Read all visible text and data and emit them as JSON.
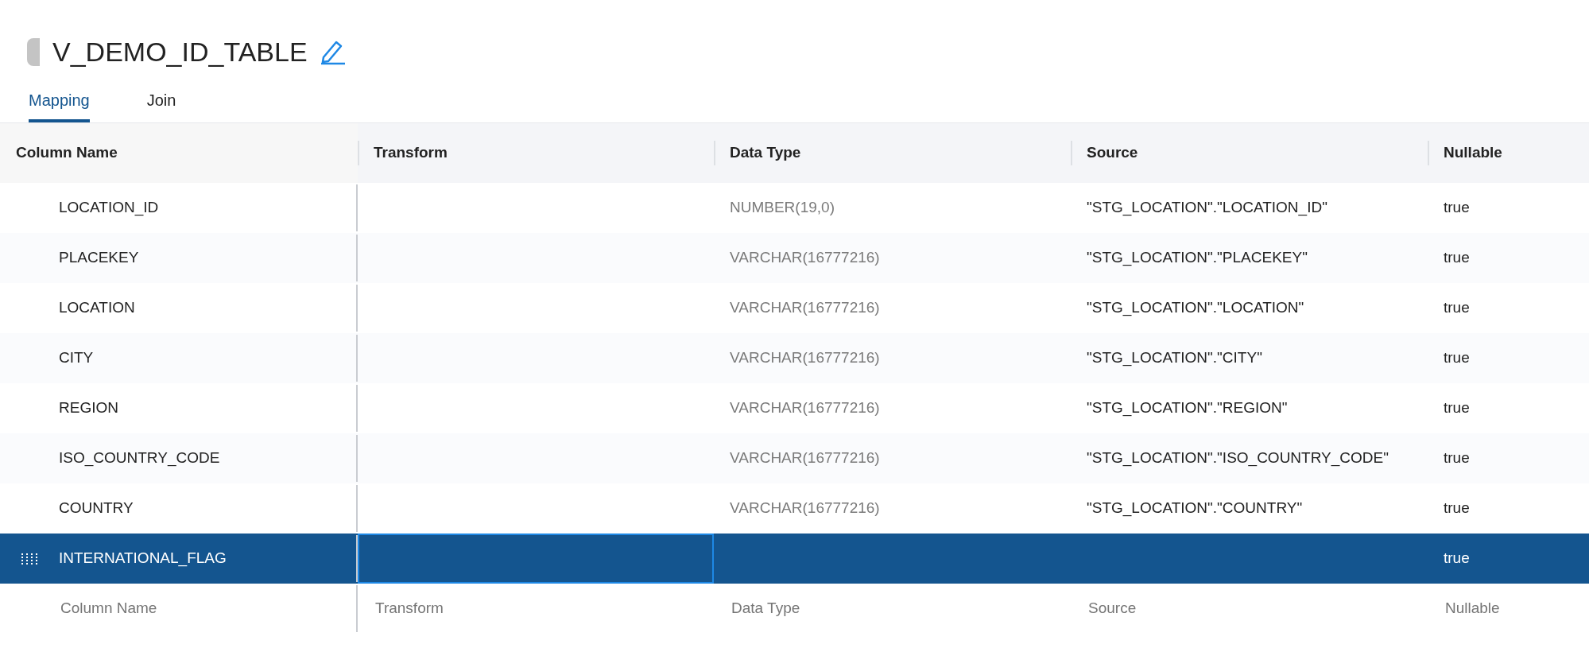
{
  "title": "V_DEMO_ID_TABLE",
  "tabs": [
    {
      "label": "Mapping",
      "selected": true
    },
    {
      "label": "Join",
      "selected": false
    }
  ],
  "table": {
    "columns": [
      "Column Name",
      "Transform",
      "Data Type",
      "Source",
      "Nullable"
    ],
    "rows": [
      {
        "column_name": "LOCATION_ID",
        "data_type": "NUMBER(19,0)",
        "source": "\"STG_LOCATION\".\"LOCATION_ID\"",
        "nullable": "true",
        "selected": false
      },
      {
        "column_name": "PLACEKEY",
        "data_type": "VARCHAR(16777216)",
        "source": "\"STG_LOCATION\".\"PLACEKEY\"",
        "nullable": "true",
        "selected": false
      },
      {
        "column_name": "LOCATION",
        "data_type": "VARCHAR(16777216)",
        "source": "\"STG_LOCATION\".\"LOCATION\"",
        "nullable": "true",
        "selected": false
      },
      {
        "column_name": "CITY",
        "data_type": "VARCHAR(16777216)",
        "source": "\"STG_LOCATION\".\"CITY\"",
        "nullable": "true",
        "selected": false
      },
      {
        "column_name": "REGION",
        "data_type": "VARCHAR(16777216)",
        "source": "\"STG_LOCATION\".\"REGION\"",
        "nullable": "true",
        "selected": false
      },
      {
        "column_name": "ISO_COUNTRY_CODE",
        "data_type": "VARCHAR(16777216)",
        "source": "\"STG_LOCATION\".\"ISO_COUNTRY_CODE\"",
        "nullable": "true",
        "selected": false
      },
      {
        "column_name": "COUNTRY",
        "data_type": "VARCHAR(16777216)",
        "source": "\"STG_LOCATION\".\"COUNTRY\"",
        "nullable": "true",
        "selected": false
      },
      {
        "column_name": "INTERNATIONAL_FLAG",
        "nullable": "true",
        "selected": true
      }
    ],
    "new_row": {
      "column_name_placeholder": "Column Name",
      "transform_placeholder": "Transform",
      "data_type_placeholder": "Data Type",
      "source_placeholder": "Source",
      "nullable_placeholder": "Nullable"
    }
  }
}
